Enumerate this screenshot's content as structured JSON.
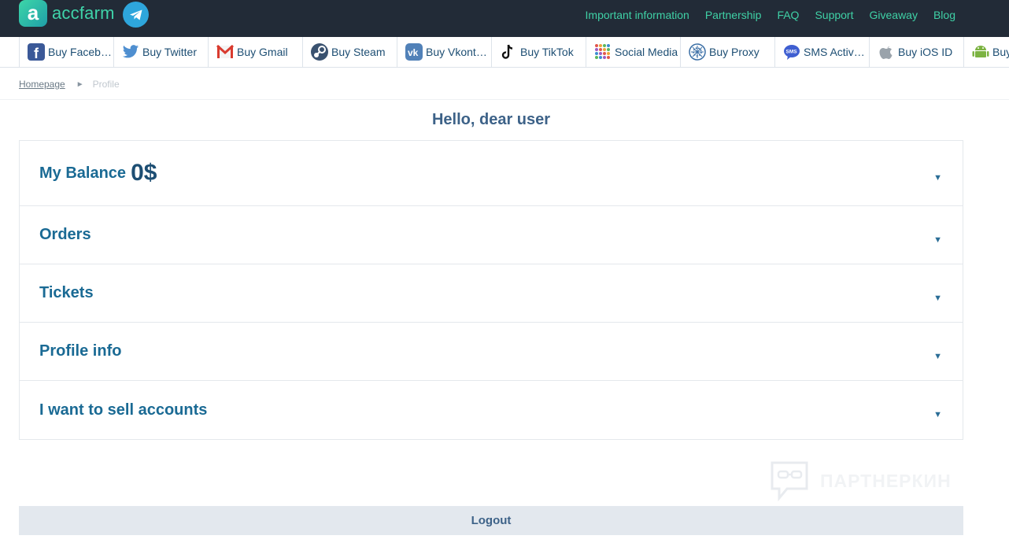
{
  "header": {
    "logo_letter": "a",
    "logo_text": "accfarm",
    "nav": [
      "Important information",
      "Partnership",
      "FAQ",
      "Support",
      "Giveaway",
      "Blog"
    ]
  },
  "categories": [
    {
      "label": "Buy Facebook",
      "icon": "facebook-icon"
    },
    {
      "label": "Buy Twitter",
      "icon": "twitter-icon"
    },
    {
      "label": "Buy Gmail",
      "icon": "gmail-icon"
    },
    {
      "label": "Buy Steam",
      "icon": "steam-icon"
    },
    {
      "label": "Buy Vkontakte",
      "icon": "vk-icon"
    },
    {
      "label": "Buy TikTok",
      "icon": "tiktok-icon"
    },
    {
      "label": "Social Media",
      "icon": "social-grid-icon"
    },
    {
      "label": "Buy Proxy",
      "icon": "proxy-icon"
    },
    {
      "label": "SMS Activation",
      "icon": "sms-icon"
    },
    {
      "label": "Buy iOS ID",
      "icon": "apple-icon"
    },
    {
      "label": "Buy Android",
      "icon": "android-icon"
    }
  ],
  "breadcrumb": {
    "home": "Homepage",
    "separator": "►",
    "current": "Profile"
  },
  "greeting": "Hello, dear user",
  "sections": {
    "balance": {
      "label": "My Balance",
      "value": "0$"
    },
    "orders": "Orders",
    "tickets": "Tickets",
    "profile": "Profile info",
    "sell": "I want to sell accounts",
    "arrow": "▼"
  },
  "watermark": "ПАРТНЕРКИН",
  "logout": "Logout",
  "colors": {
    "header_bg": "#222b37",
    "accent": "#3fd1a6",
    "title": "#1a6a94"
  }
}
